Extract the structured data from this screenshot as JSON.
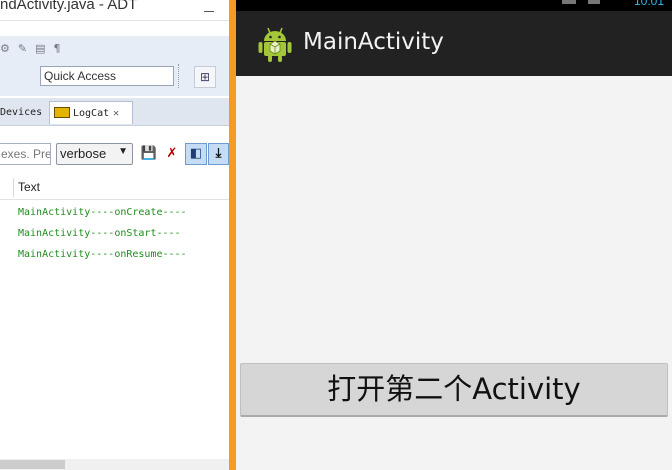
{
  "eclipse": {
    "window_title": "ndActivity.java - ADT",
    "quick_access_placeholder": "Quick Access",
    "tabs": [
      {
        "label": "Devices"
      },
      {
        "label": "LogCat",
        "close": "✕"
      }
    ],
    "logcat": {
      "filter_text": "exes. Pre",
      "log_level": "verbose",
      "columns": [
        "Text"
      ],
      "rows": [
        {
          "text": "MainActivity----onCreate----"
        },
        {
          "text": "MainActivity----onStart----"
        },
        {
          "text": "MainActivity----onResume----"
        }
      ],
      "row_color": "#1e8c1e"
    },
    "icons": {
      "save": "save-icon",
      "clear": "clear-log-icon",
      "toggle": "toggle-panel-icon",
      "scroll_lock": "scroll-lock-icon"
    }
  },
  "device": {
    "status_time": "10:01",
    "app_title": "MainActivity",
    "button_label": "打开第二个Activity",
    "accent_color": "#f79a24"
  }
}
